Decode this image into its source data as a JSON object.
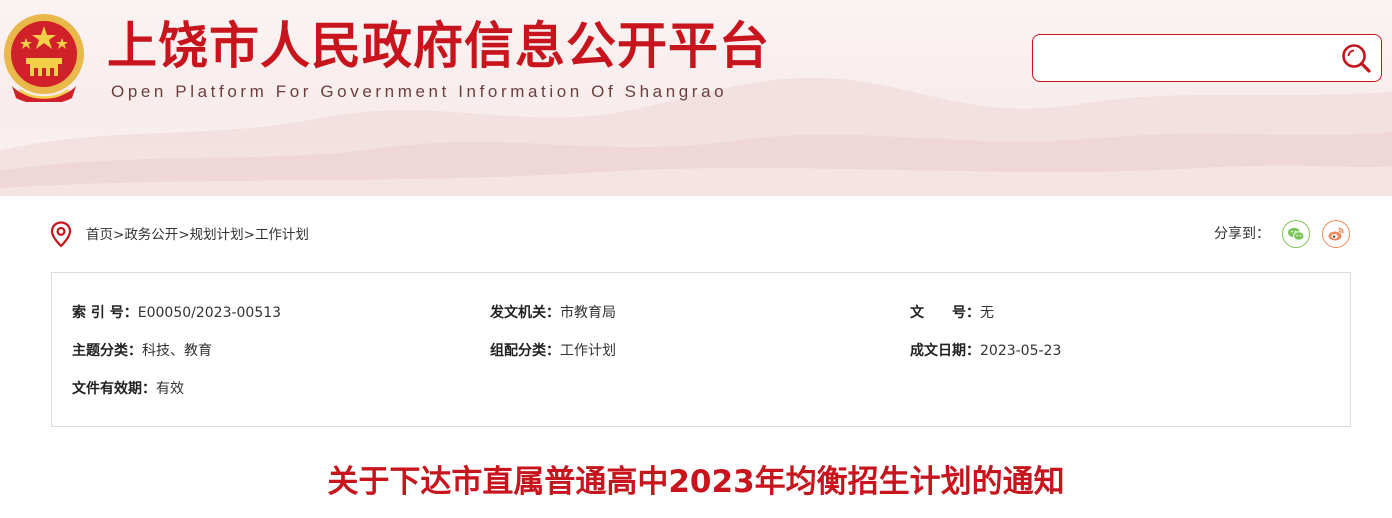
{
  "header": {
    "title": "上饶市人民政府信息公开平台",
    "subtitle": "Open Platform For Government Information Of Shangrao"
  },
  "search": {
    "placeholder": "",
    "value": "",
    "icon": "search-icon"
  },
  "breadcrumb": {
    "icon": "location-pin-icon",
    "items": [
      "首页",
      "政务公开",
      "规划计划",
      "工作计划"
    ],
    "separator": ">"
  },
  "share": {
    "label": "分享到：",
    "targets": [
      "wechat-icon",
      "weibo-icon"
    ]
  },
  "meta": {
    "index_label": "索 引 号：",
    "index_value": "E00050/2023-00513",
    "issuer_label": "发文机关：",
    "issuer_value": "市教育局",
    "docno_label": "文　　号：",
    "docno_value": "无",
    "topic_label": "主题分类：",
    "topic_value": "科技、教育",
    "category_label": "组配分类：",
    "category_value": "工作计划",
    "date_label": "成文日期：",
    "date_value": "2023-05-23",
    "validity_label": "文件有效期：",
    "validity_value": "有效"
  },
  "document": {
    "title": "关于下达市直属普通高中2023年均衡招生计划的通知"
  },
  "colors": {
    "brand_red": "#c8141d",
    "wechat_green": "#7bc65a",
    "weibo_orange": "#f08a5a"
  }
}
